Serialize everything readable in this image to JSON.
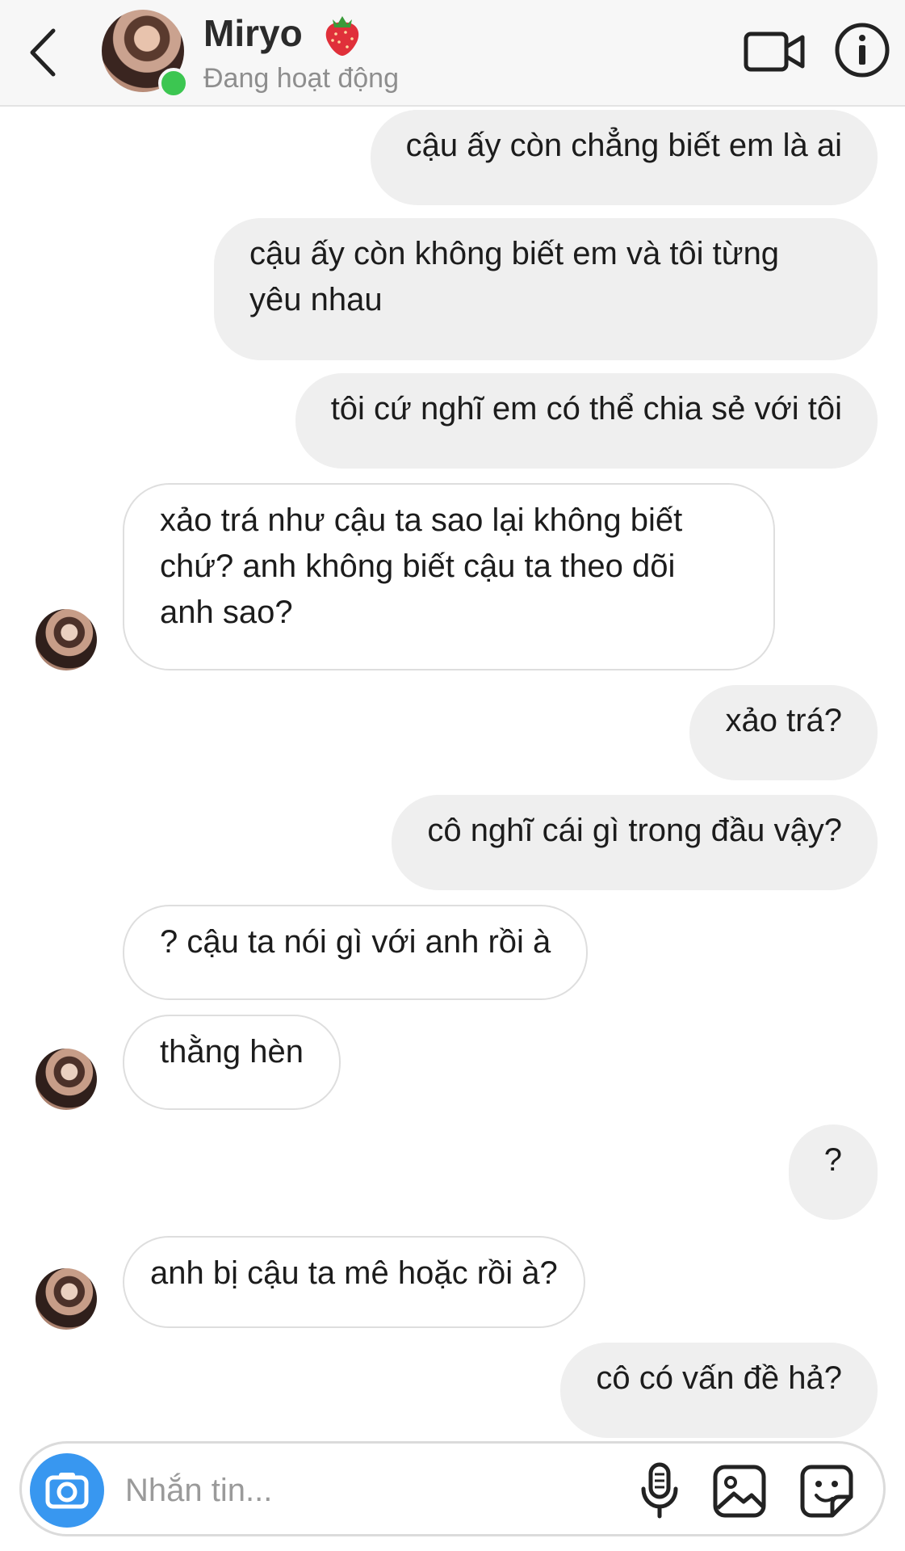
{
  "header": {
    "contact_name": "Miryo",
    "status": "Đang hoạt động",
    "name_emoji_icon": "strawberry-icon",
    "online_color": "#3cc651",
    "icons": [
      "back-arrow-icon",
      "video-call-icon",
      "info-icon"
    ]
  },
  "messages": [
    {
      "sender": "me",
      "lines": [
        "cậu ấy còn chẳng biết em là ai"
      ]
    },
    {
      "sender": "me",
      "lines": [
        "cậu ấy còn không biết em và tôi từng",
        "yêu nhau"
      ]
    },
    {
      "sender": "me",
      "lines": [
        "tôi cứ nghĩ em có thể chia sẻ với tôi"
      ]
    },
    {
      "sender": "them",
      "lines": [
        "xảo trá như cậu ta sao lại không biết",
        "chứ? anh không biết cậu ta theo dõi",
        "anh sao?"
      ]
    },
    {
      "sender": "me",
      "lines": [
        "xảo trá?"
      ]
    },
    {
      "sender": "me",
      "lines": [
        "cô nghĩ cái gì trong đầu vậy?"
      ]
    },
    {
      "sender": "them",
      "lines": [
        "? cậu ta nói gì với anh rồi à"
      ]
    },
    {
      "sender": "them",
      "lines": [
        "thằng hèn"
      ]
    },
    {
      "sender": "me",
      "lines": [
        "?"
      ]
    },
    {
      "sender": "them",
      "lines": [
        "anh bị cậu ta mê hoặc rồi à?"
      ]
    },
    {
      "sender": "me",
      "lines": [
        "cô có vấn đề hả?"
      ]
    }
  ],
  "composer": {
    "placeholder": "Nhắn tin...",
    "accent_color": "#3897f0",
    "icons": [
      "camera-icon",
      "microphone-icon",
      "gallery-icon",
      "sticker-icon"
    ]
  }
}
